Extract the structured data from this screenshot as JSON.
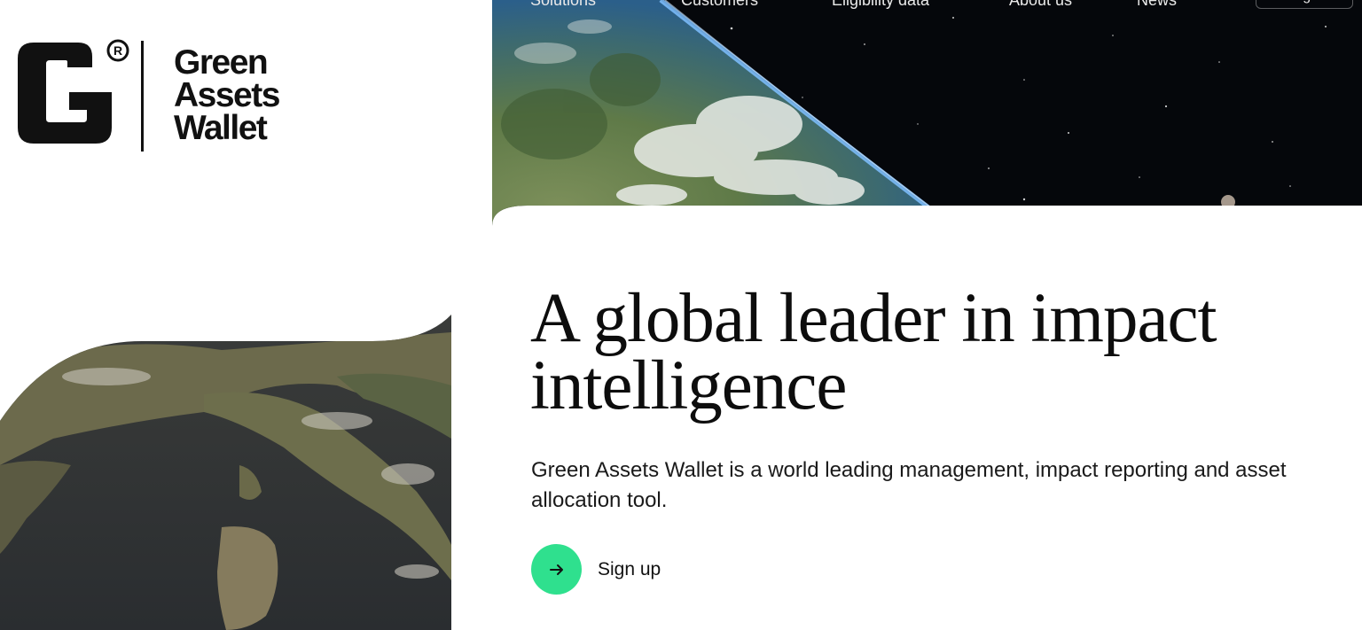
{
  "brand": {
    "name_lines": [
      "Green",
      "Assets",
      "Wallet"
    ],
    "registered_mark": "®"
  },
  "nav": {
    "items": [
      {
        "label": "Solutions"
      },
      {
        "label": "Customers"
      },
      {
        "label": "Eligibility data"
      },
      {
        "label": "About us"
      },
      {
        "label": "News"
      }
    ],
    "login_label": "Login"
  },
  "hero": {
    "headline_line1": "A global leader in impact",
    "headline_line2": "intelligence",
    "subcopy": "Green Assets Wallet is a world leading management, impact reporting and asset allocation tool.",
    "cta": {
      "label": "Sign up",
      "icon": "arrow-right-icon"
    }
  },
  "colors": {
    "accent": "#2fe08e",
    "text": "#111111",
    "background": "#ffffff",
    "space": "#05070b"
  }
}
